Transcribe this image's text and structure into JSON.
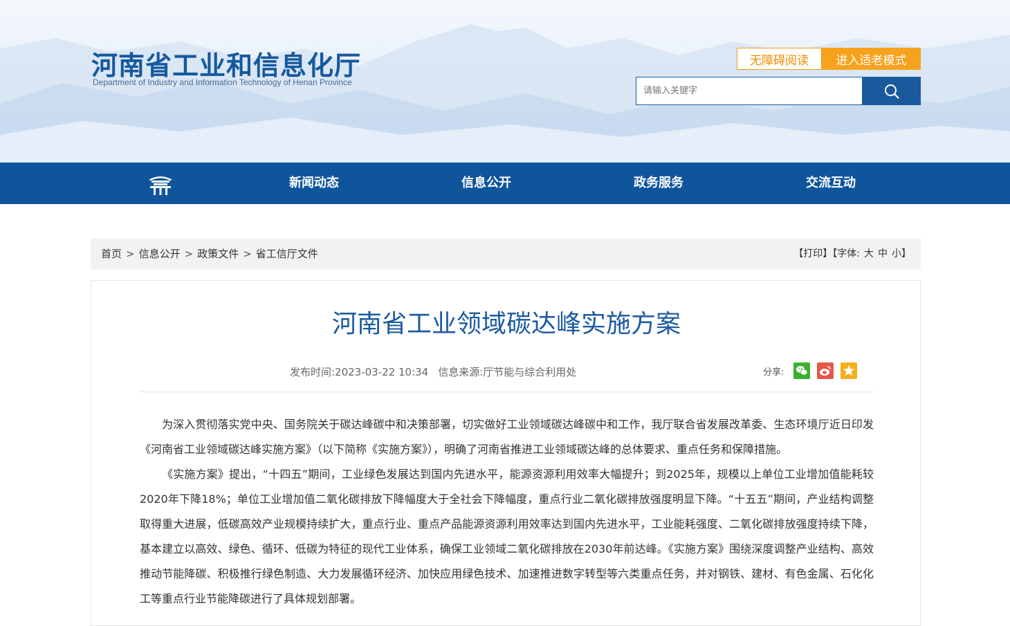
{
  "header": {
    "title_cn": "河南省工业和信息化厅",
    "title_en": "Department of Industry and Information Technology of Henan Province",
    "accessibility_label": "无障碍阅读",
    "elder_mode_label": "进入适老模式",
    "search_placeholder": "请输入关键字"
  },
  "nav": {
    "items": [
      {
        "label": "新闻动态"
      },
      {
        "label": "信息公开"
      },
      {
        "label": "政务服务"
      },
      {
        "label": "交流互动"
      }
    ]
  },
  "breadcrumb": {
    "items": [
      "首页",
      "信息公开",
      "政策文件",
      "省工信厅文件"
    ],
    "separator": ">"
  },
  "tools": {
    "print": "【打印】",
    "font_prefix": "【字体:",
    "font_large": "大",
    "font_medium": "中",
    "font_small": "小",
    "font_suffix": "】"
  },
  "article": {
    "title": "河南省工业领域碳达峰实施方案",
    "publish_time": "发布时间:2023-03-22 10:34",
    "source": "信息来源:厅节能与综合利用处",
    "share_label": "分享:",
    "paragraphs": [
      "为深入贯彻落实党中央、国务院关于碳达峰碳中和决策部署，切实做好工业领域碳达峰碳中和工作，我厅联合省发展改革委、生态环境厅近日印发《河南省工业领域碳达峰实施方案》（以下简称《实施方案》），明确了河南省推进工业领域碳达峰的总体要求、重点任务和保障措施。",
      "《实施方案》提出，“十四五”期间，工业绿色发展达到国内先进水平，能源资源利用效率大幅提升；到2025年，规模以上单位工业增加值能耗较2020年下降18%；单位工业增加值二氧化碳排放下降幅度大于全社会下降幅度，重点行业二氧化碳排放强度明显下降。“十五五”期间，产业结构调整取得重大进展，低碳高效产业规模持续扩大，重点行业、重点产品能源资源利用效率达到国内先进水平，工业能耗强度、二氧化碳排放强度持续下降，基本建立以高效、绿色、循环、低碳为特征的现代工业体系，确保工业领域二氧化碳排放在2030年前达峰。《实施方案》围绕深度调整产业结构、高效推动节能降碳、积极推行绿色制造、大力发展循环经济、加快应用绿色技术、加速推进数字转型等六类重点任务，并对钢铁、建材、有色金属、石化化工等重点行业节能降碳进行了具体规划部署。"
    ]
  },
  "colors": {
    "brand_blue": "#0f559c",
    "title_blue": "#1d5aa1",
    "accent_orange": "#f7a21d",
    "wechat_green": "#3cb034",
    "weibo_red": "#e6564a",
    "favorite_yellow": "#f2b01e"
  },
  "icons": {
    "home": "pavilion-home-icon",
    "search": "search-icon",
    "share": [
      "wechat-icon",
      "weibo-icon",
      "favorite-icon"
    ]
  }
}
